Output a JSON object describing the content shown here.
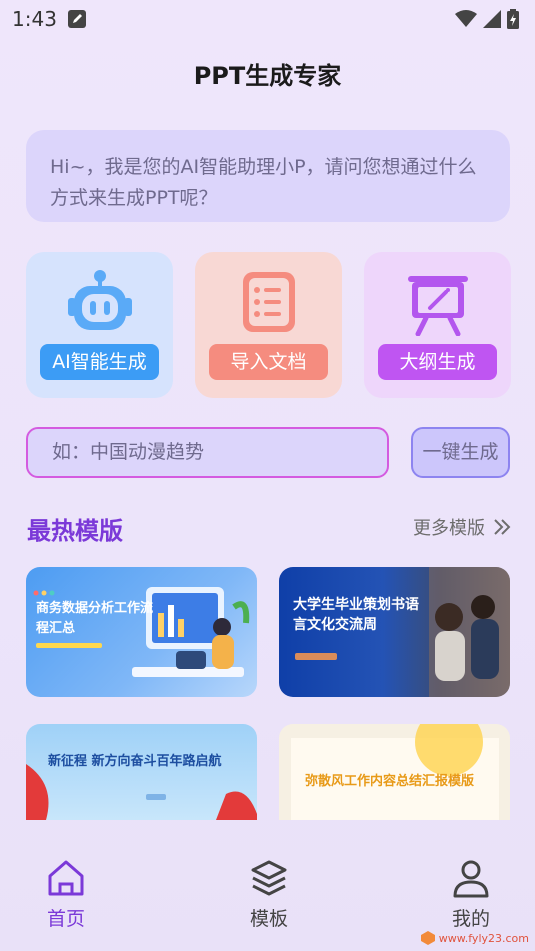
{
  "status": {
    "time": "1:43"
  },
  "app": {
    "title": "PPT生成专家"
  },
  "greeting": "Hi~，我是您的AI智能助理小P，请问您想通过什么方式来生成PPT呢？",
  "modes": [
    {
      "label": "AI智能生成",
      "icon": "robot-icon",
      "color": "#3c9cf5"
    },
    {
      "label": "导入文档",
      "icon": "document-list-icon",
      "color": "#f58c7f"
    },
    {
      "label": "大纲生成",
      "icon": "presentation-board-icon",
      "color": "#bf55f2"
    }
  ],
  "prompt": {
    "placeholder": "如：中国动漫趋势",
    "button": "一键生成"
  },
  "hot": {
    "title": "最热模版",
    "more": "更多模版"
  },
  "templates": [
    {
      "title": "商务数据分析工作流程汇总"
    },
    {
      "title": "大学生毕业策划书语言文化交流周"
    },
    {
      "title": "新征程 新方向奋斗百年路启航"
    },
    {
      "title": "弥散风工作内容总结汇报模版"
    }
  ],
  "nav": [
    {
      "label": "首页",
      "icon": "home-icon",
      "active": true
    },
    {
      "label": "模板",
      "icon": "layers-icon",
      "active": false
    },
    {
      "label": "我的",
      "icon": "user-icon",
      "active": false
    }
  ],
  "accent": "#7b39d8",
  "watermark": "www.fyly23.com"
}
